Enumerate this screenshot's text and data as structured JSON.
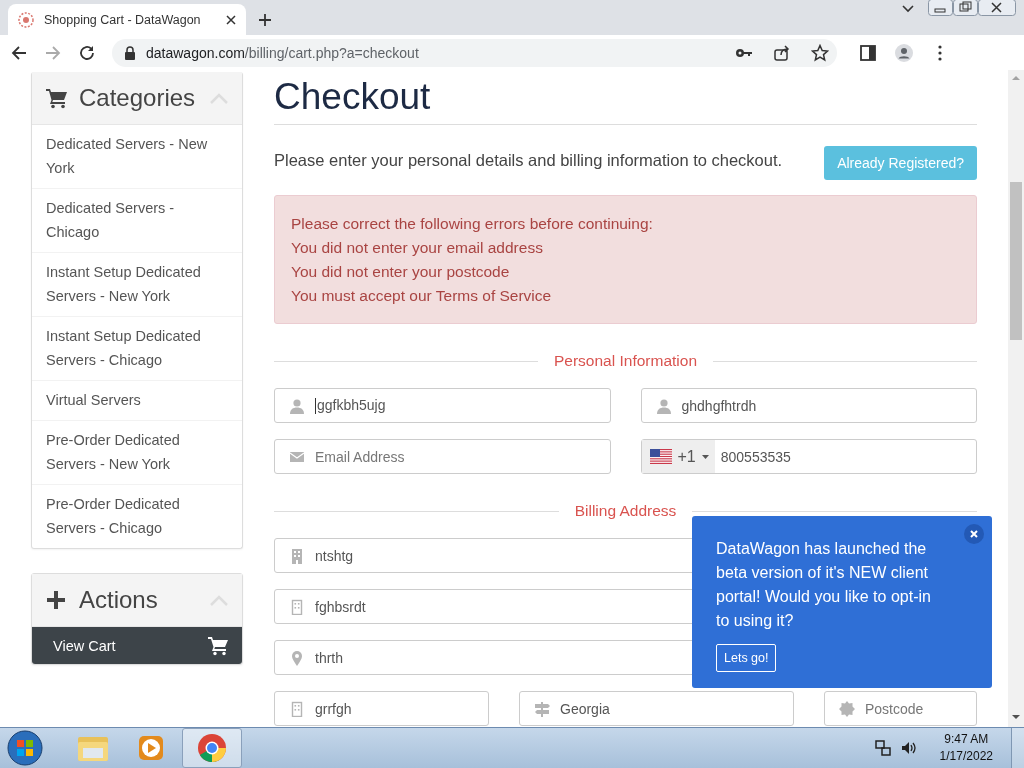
{
  "browser": {
    "tab_title": "Shopping Cart - DataWagon",
    "url_host": "datawagon.com",
    "url_path": "/billing/cart.php?a=checkout"
  },
  "sidebar": {
    "panels": [
      {
        "kind": "categories",
        "title": "Categories",
        "items": [
          "Dedicated Servers - New York",
          "Dedicated Servers - Chicago",
          "Instant Setup Dedicated Servers - New York",
          "Instant Setup Dedicated Servers - Chicago",
          "Virtual Servers",
          "Pre-Order Dedicated Servers - New York",
          "Pre-Order Dedicated Servers - Chicago"
        ]
      },
      {
        "kind": "actions",
        "title": "Actions",
        "items": [
          "View Cart"
        ]
      }
    ]
  },
  "checkout": {
    "title": "Checkout",
    "intro": "Please enter your personal details and billing information to checkout.",
    "login_button": "Already Registered?",
    "errors": {
      "heading": "Please correct the following errors before continuing:",
      "items": [
        "You did not enter your email address",
        "You did not enter your postcode",
        "You must accept our Terms of Service"
      ]
    },
    "sections": [
      {
        "title": "Personal Information",
        "rows": [
          [
            {
              "kind": "person",
              "value": "ggfkbh5ujg",
              "focused": true
            },
            {
              "kind": "person",
              "value": "ghdhgfhtrdh",
              "focused": false
            }
          ],
          [
            {
              "kind": "envelope",
              "placeholder": "Email Address",
              "focused": false
            },
            {
              "kind": "phone",
              "country_code": "+1",
              "value": "800553535",
              "focused": false
            }
          ]
        ]
      },
      {
        "title": "Billing Address",
        "rows": [
          [
            {
              "kind": "building",
              "value": "ntshtg",
              "focused": false
            }
          ],
          [
            {
              "kind": "building-outline",
              "value": "fghbsrdt",
              "focused": false
            }
          ],
          [
            {
              "kind": "pin",
              "value": "thrth",
              "focused": false
            }
          ],
          [
            {
              "kind": "building-outline",
              "value": "grrfgh",
              "focused": false
            },
            {
              "kind": "sign",
              "value": "Georgia",
              "focused": false
            },
            {
              "kind": "seal",
              "placeholder": "Postcode",
              "focused": false
            }
          ]
        ]
      }
    ]
  },
  "popup": {
    "message": "DataWagon has launched the beta version of it's NEW client portal! Would you like to opt-in to using it?",
    "button": "Lets go!"
  },
  "taskbar": {
    "time": "9:47 AM",
    "date": "1/17/2022"
  }
}
